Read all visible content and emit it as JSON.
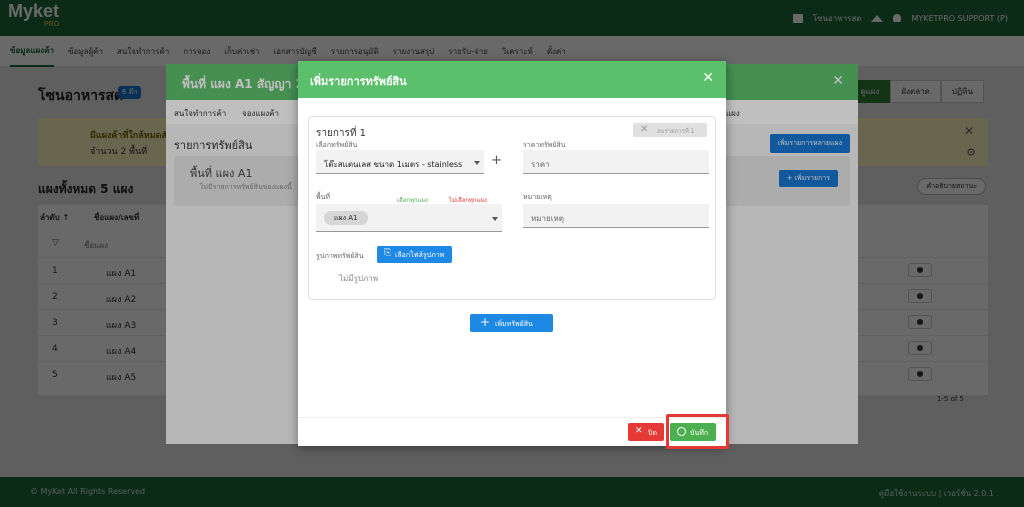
{
  "app": {
    "logo": "Myket",
    "logo_sub": "PRO",
    "topbar_store": "โซนอาหารสด",
    "topbar_user": "MYKETPRO SUPPORT (P)"
  },
  "nav": [
    "ข้อมูลแผงค้า",
    "ข้อมูลผู้ค้า",
    "สนใจทำการค้า",
    "การจอง",
    "เก็บค่าเช่า",
    "เอกสารบัญชี",
    "รายการอนุมัติ",
    "รายงานสรุป",
    "รายรับ-จ่าย",
    "วิเคราะห์",
    "ตั้งค่า"
  ],
  "bg": {
    "title": "โซนอาหารสด",
    "badge": "6 ตึก",
    "tabs": [
      "ดูแผง",
      "ผังตลาด",
      "ปฏิทิน"
    ],
    "alert_title": "มีแผงค้าที่ใกล้หมดสัญญา",
    "alert_text": "จำนวน 2 พื้นที่",
    "section": "แผงทั้งหมด 5 แผง",
    "help": "คำอธิบายสถานะ",
    "col_order": "ลำดับ ↑",
    "col_name": "ชื่อแผง/เลขที่",
    "filter_placeholder": "ชื่อแผง",
    "rows": [
      {
        "n": "1",
        "name": "แผง A1"
      },
      {
        "n": "2",
        "name": "แผง A2"
      },
      {
        "n": "3",
        "name": "แผง A3"
      },
      {
        "n": "4",
        "name": "แผง A4"
      },
      {
        "n": "5",
        "name": "แผง A5"
      }
    ],
    "pager": "1-5 of 5",
    "footer_left": "© MyKet All Rights Reserved",
    "footer_right": "คู่มือใช้งานระบบ | เวอร์ชั่น 2.0.1"
  },
  "mid": {
    "title": "พื้นที่ แผง A1 สัญญา 20",
    "tabs": [
      "สนใจทำการค้า",
      "จองแผงค้า",
      "แผง"
    ],
    "section": "รายการทรัพย์สิน",
    "btn_multi": "เพิ่มรายการหลายแผง",
    "card_title": "พื้นที่ แผง A1",
    "card_sub": "ไม่มีรายการทรัพย์สินของแผงนี้",
    "card_btn": "+ เพิ่มรายการ"
  },
  "dialog": {
    "title": "เพิ่มรายการทรัพย์สิน",
    "item_title": "รายการที่ 1",
    "delete_item": "ลบรายการที่ 1",
    "asset_label": "เลือกทรัพย์สิน",
    "asset_value": "โต๊ะสแตนเลส ขนาด 1เมตร - stainless",
    "price_label": "ราคาทรัพย์สิน",
    "price_placeholder": "ราคา",
    "area_label": "พื้นที่",
    "select_all": "เลือกทุกแผง",
    "deselect_all": "ไม่เลือกทุกแผง",
    "area_chip": "แผง A1",
    "note_label": "หมายเหตุ",
    "note_placeholder": "หมายเหตุ",
    "image_label": "รูปภาพทรัพย์สิน",
    "upload_button": "เลือกไฟล์รูปภาพ",
    "no_image": "ไม่มีรูปภาพ",
    "add_asset": "เพิ่มทรัพย์สิน",
    "close_button": "ปิด",
    "save_button": "บันทึก"
  }
}
